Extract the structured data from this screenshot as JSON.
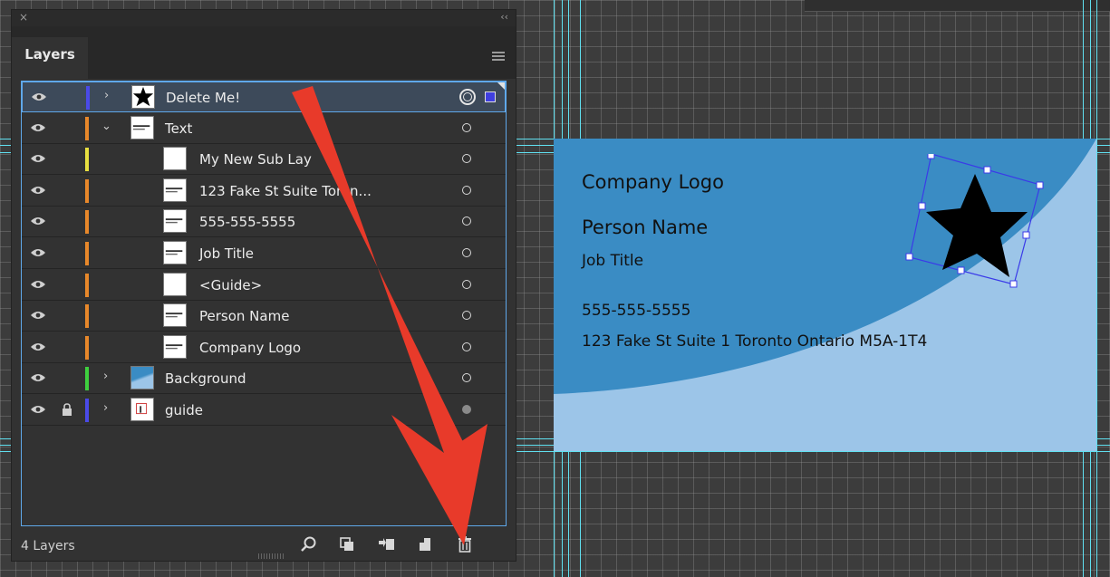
{
  "panel": {
    "close_glyph": "×",
    "collapse_glyph": "‹‹",
    "tab_label": "Layers",
    "footer_count": "4 Layers"
  },
  "layers": [
    {
      "name": "Delete Me!",
      "indent": 0,
      "expandable": true,
      "expanded": false,
      "color": "#4a4ae8",
      "thumb": "star-icon",
      "selected": true,
      "locked": false
    },
    {
      "name": "Text",
      "indent": 0,
      "expandable": true,
      "expanded": true,
      "color": "#e8882a",
      "thumb": "text-thumb",
      "selected": false,
      "locked": false
    },
    {
      "name": "My New Sub Lay",
      "indent": 1,
      "expandable": false,
      "color": "#e8e040",
      "thumb": "blank-thumb",
      "selected": false,
      "locked": false
    },
    {
      "name": "123 Fake St Suite   Toron...",
      "indent": 1,
      "expandable": false,
      "color": "#e8882a",
      "thumb": "text-thumb",
      "selected": false,
      "locked": false
    },
    {
      "name": "555-555-5555",
      "indent": 1,
      "expandable": false,
      "color": "#e8882a",
      "thumb": "text-thumb",
      "selected": false,
      "locked": false
    },
    {
      "name": "Job Title",
      "indent": 1,
      "expandable": false,
      "color": "#e8882a",
      "thumb": "text-thumb",
      "selected": false,
      "locked": false
    },
    {
      "name": "<Guide>",
      "indent": 1,
      "expandable": false,
      "color": "#e8882a",
      "thumb": "blank-thumb",
      "selected": false,
      "locked": false
    },
    {
      "name": "Person Name",
      "indent": 1,
      "expandable": false,
      "color": "#e8882a",
      "thumb": "text-thumb",
      "selected": false,
      "locked": false
    },
    {
      "name": "Company Logo",
      "indent": 1,
      "expandable": false,
      "color": "#e8882a",
      "thumb": "text-thumb",
      "selected": false,
      "locked": false
    },
    {
      "name": "Background",
      "indent": 0,
      "expandable": true,
      "expanded": false,
      "color": "#3ed03e",
      "thumb": "gradient-thumb",
      "selected": false,
      "locked": false
    },
    {
      "name": "guide",
      "indent": 0,
      "expandable": true,
      "expanded": false,
      "color": "#4a4ae8",
      "thumb": "guide-thumb",
      "selected": false,
      "locked": true
    }
  ],
  "card": {
    "company": "Company Logo",
    "person": "Person Name",
    "job": "Job Title",
    "phone": "555-555-5555",
    "address": "123 Fake St Suite 1 Toronto Ontario M5A-1T4",
    "bg_light": "#9cc5e8",
    "bg_dark": "#3a8cc4"
  },
  "footer_icons": [
    "search-icon",
    "clipping-mask-icon",
    "move-to-layer-icon",
    "new-layer-icon",
    "trash-icon"
  ],
  "annotation": {
    "arrow_color": "#e83a2a"
  }
}
